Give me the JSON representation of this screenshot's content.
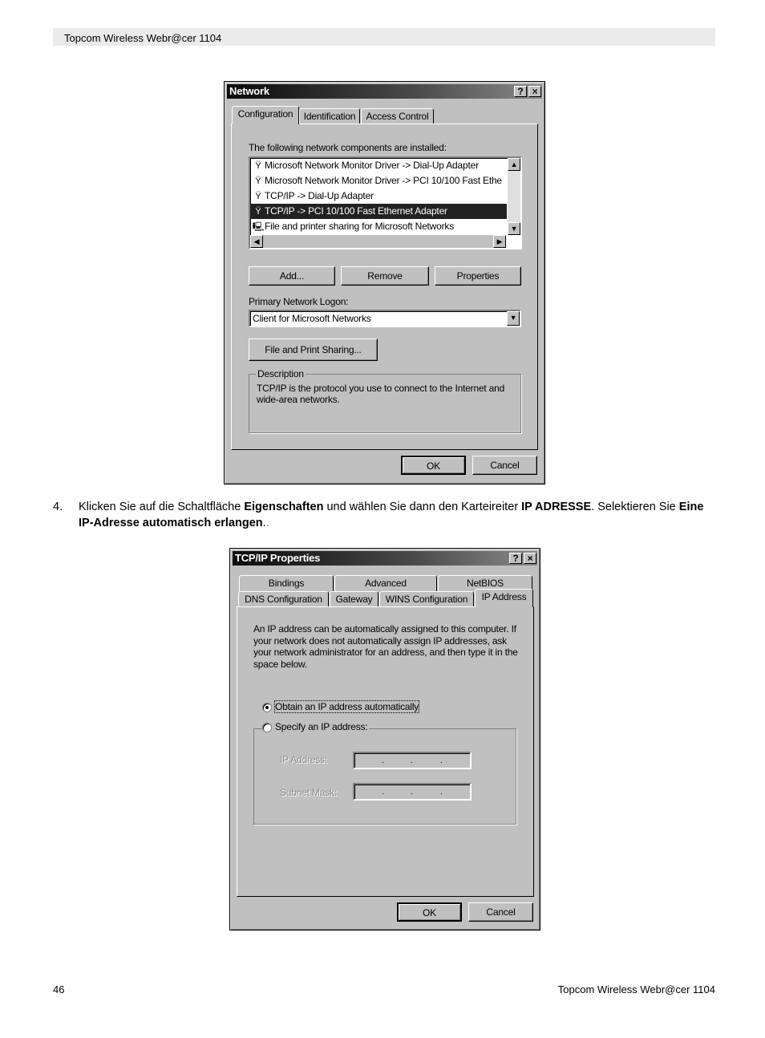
{
  "page": {
    "header": "Topcom Wireless Webr@cer 1104",
    "footer_page": "46",
    "footer_title": "Topcom Wireless Webr@cer 1104",
    "step": {
      "number": "4.",
      "t1": "Klicken Sie auf die Schaltfläche ",
      "b1": "Eigenschaften",
      "t2": " und wählen Sie dann den Karteireiter ",
      "b2": "IP ADRESSE",
      "t3": ". Selektieren Sie ",
      "b3": "Eine IP-Adresse automatisch erlangen",
      "t4": ".",
      "t5": "."
    }
  },
  "network_dialog": {
    "title": "Network",
    "help": "?",
    "close": "×",
    "tabs": [
      "Configuration",
      "Identification",
      "Access Control"
    ],
    "active_tab": "Configuration",
    "components_label": "The following network components are installed:",
    "components": [
      {
        "icon": "adapter-icon",
        "label": "Microsoft Network Monitor Driver -> Dial-Up Adapter"
      },
      {
        "icon": "adapter-icon",
        "label": "Microsoft Network Monitor Driver -> PCI 10/100 Fast Ethe"
      },
      {
        "icon": "adapter-icon",
        "label": "TCP/IP -> Dial-Up Adapter"
      },
      {
        "icon": "adapter-icon",
        "label": "TCP/IP -> PCI 10/100 Fast Ethernet Adapter",
        "selected": true
      },
      {
        "icon": "computer-icon",
        "label": "File and printer sharing for Microsoft Networks"
      }
    ],
    "add": "Add...",
    "remove": "Remove",
    "properties": "Properties",
    "logon_label": "Primary Network Logon:",
    "logon_value": "Client for Microsoft Networks",
    "file_print": "File and Print Sharing...",
    "description_label": "Description",
    "description": "TCP/IP is the protocol you use to connect to the Internet and wide-area networks.",
    "ok": "OK",
    "cancel": "Cancel"
  },
  "tcpip_dialog": {
    "title": "TCP/IP Properties",
    "help": "?",
    "close": "×",
    "tabs_row1": [
      "Bindings",
      "Advanced",
      "NetBIOS"
    ],
    "tabs_row2": [
      "DNS Configuration",
      "Gateway",
      "WINS Configuration",
      "IP Address"
    ],
    "active_tab": "IP Address",
    "info": "An IP address can be automatically assigned to this computer. If your network does not automatically assign IP addresses, ask your network administrator for an address, and then type it in the space below.",
    "radio_auto": "Obtain an IP address automatically",
    "radio_specify": "Specify an IP address:",
    "selected_option": "Obtain an IP address automatically",
    "ip_label": "IP Address:",
    "mask_label": "Subnet Mask:",
    "ok": "OK",
    "cancel": "Cancel"
  }
}
